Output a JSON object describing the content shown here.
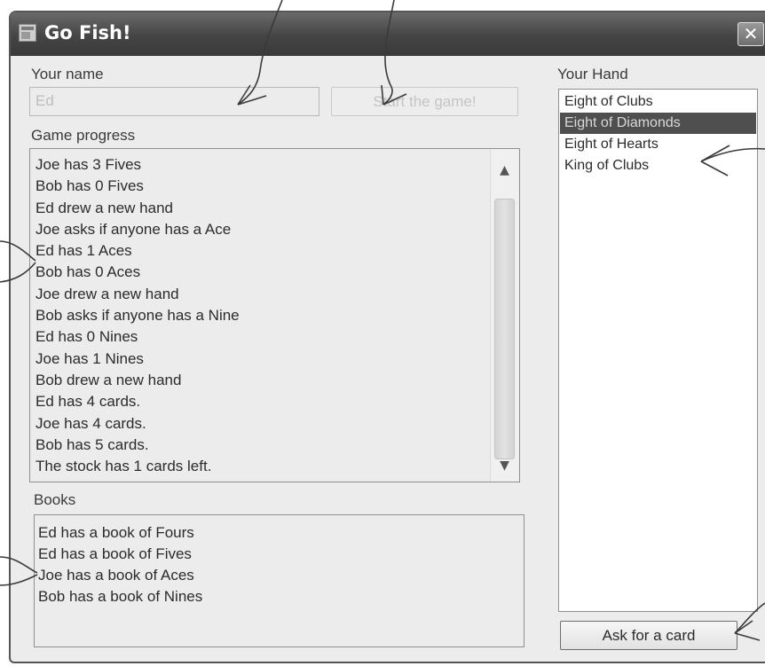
{
  "window": {
    "title": "Go Fish!",
    "close_label": "✕"
  },
  "name_section": {
    "label": "Your name",
    "value": "Ed"
  },
  "start_button": {
    "label": "Start the game!"
  },
  "progress": {
    "label": "Game progress",
    "lines": [
      "Joe has 3 Fives",
      "Bob has 0 Fives",
      "Ed drew a new hand",
      "Joe asks if anyone has a Ace",
      "Ed has 1 Aces",
      "Bob has 0 Aces",
      "Joe drew a new hand",
      "Bob asks if anyone has a Nine",
      "Ed has 0 Nines",
      "Joe has 1 Nines",
      "Bob drew a new hand",
      "Ed has 4 cards.",
      "Joe has 4 cards.",
      "Bob has 5 cards.",
      "The stock has 1 cards left."
    ],
    "scroll_up": "▲",
    "scroll_down": "▼"
  },
  "books": {
    "label": "Books",
    "lines": [
      "Ed has a book of Fours",
      "Ed has a book of Fives",
      "Joe has a book of Aces",
      "Bob has a book of Nines"
    ]
  },
  "hand": {
    "label": "Your Hand",
    "cards": [
      "Eight of Clubs",
      "Eight of Diamonds",
      "Eight of Hearts",
      "King of Clubs"
    ],
    "selected_index": 1
  },
  "ask_button": {
    "label": "Ask for a card"
  },
  "colors": {
    "titlebar": "#454545",
    "window_bg": "#ececec",
    "selection_bg": "#4f4f4f"
  }
}
